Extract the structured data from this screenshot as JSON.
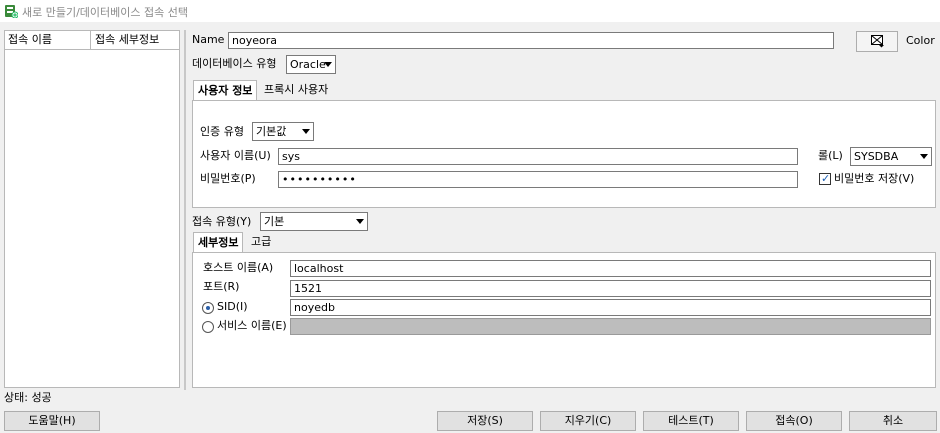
{
  "window": {
    "title": "새로 만들기/데이터베이스 접속 선택"
  },
  "connection_list": {
    "columns": [
      "접속 이름",
      "접속 세부정보"
    ]
  },
  "form": {
    "name_label": "Name",
    "name_value": "noyeora",
    "color_label": "Color",
    "db_type_label": "데이터베이스 유형",
    "db_type_value": "Oracle",
    "tabs": [
      "사용자 정보",
      "프록시 사용자"
    ],
    "auth_type_label": "인증 유형",
    "auth_type_value": "기본값",
    "username_label": "사용자 이름(U)",
    "username_value": "sys",
    "role_label": "롤(L)",
    "role_value": "SYSDBA",
    "password_label": "비밀번호(P)",
    "password_value": "••••••••••",
    "save_password_label": "비밀번호 저장(V)",
    "save_password_checked": true,
    "conn_type_label": "접속 유형(Y)",
    "conn_type_value": "기본",
    "conn_tabs": [
      "세부정보",
      "고급"
    ],
    "host_label": "호스트 이름(A)",
    "host_value": "localhost",
    "port_label": "포트(R)",
    "port_value": "1521",
    "sid_label": "SID(I)",
    "sid_value": "noyedb",
    "service_label": "서비스 이름(E)",
    "service_value": "",
    "sid_selected": true
  },
  "status": {
    "text": "상태: 성공"
  },
  "buttons": {
    "help": "도움말(H)",
    "save": "저장(S)",
    "clear": "지우기(C)",
    "test": "테스트(T)",
    "connect": "접속(O)",
    "cancel": "취소"
  },
  "colors": {
    "accent": "#2b5fa8",
    "disabled_field": "#bdbdbd",
    "window_bg": "#f0f0f0"
  }
}
